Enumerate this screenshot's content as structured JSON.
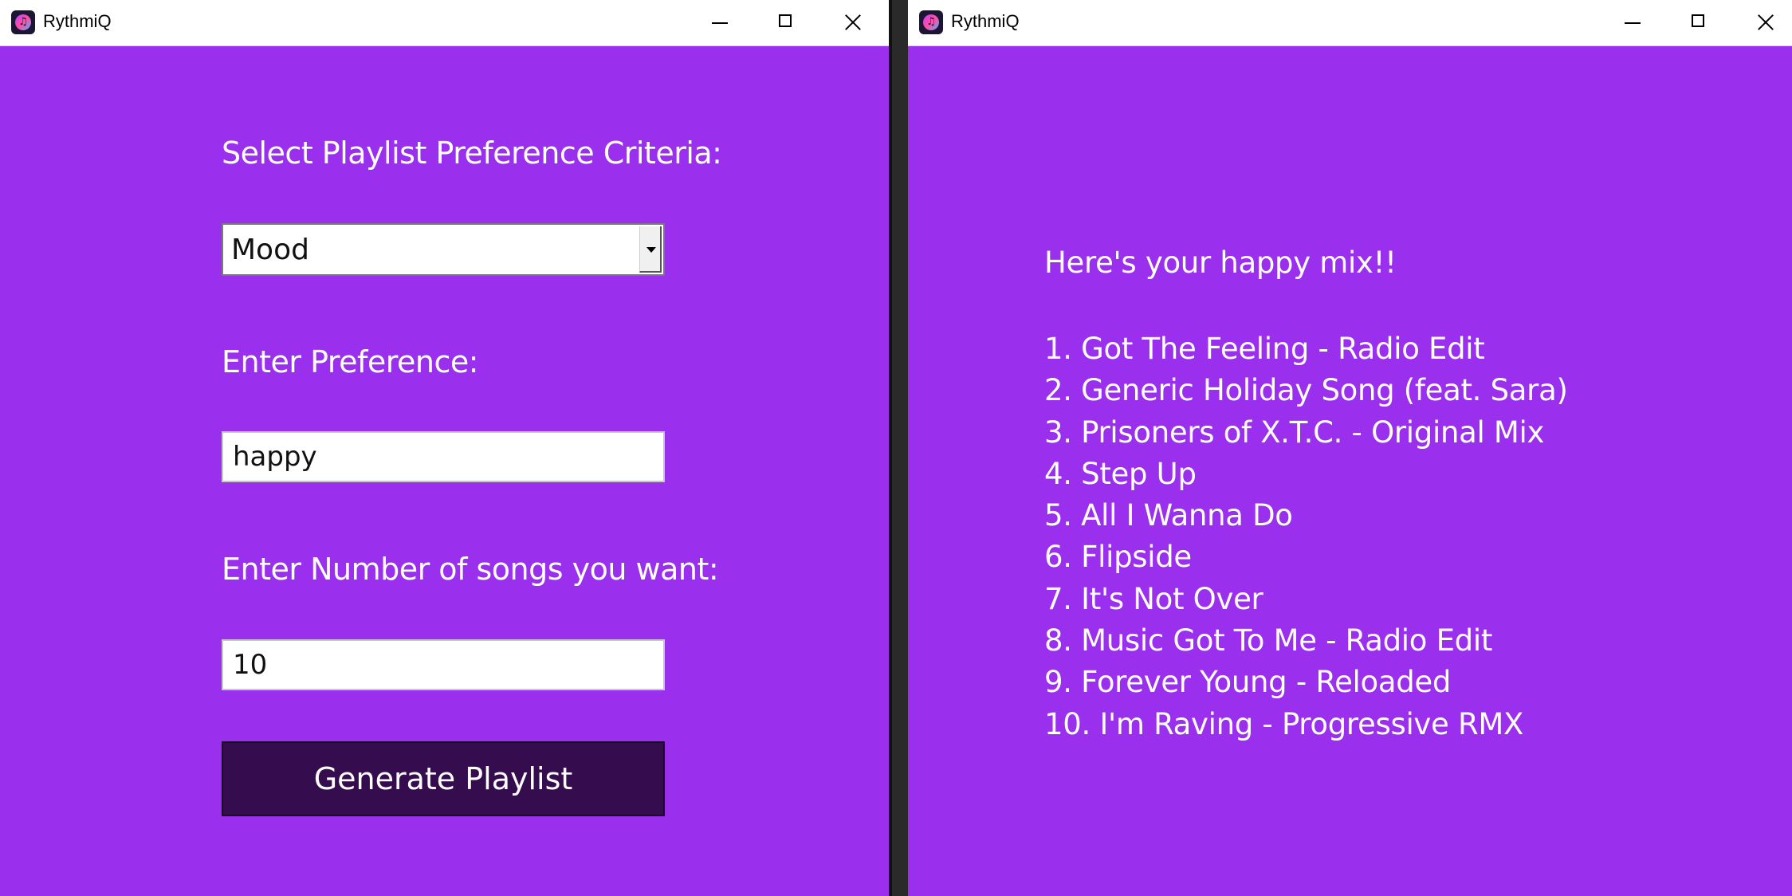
{
  "colors": {
    "background": "#9a2fee",
    "button": "#350c4d",
    "text": "#ffffff"
  },
  "left_window": {
    "title": "RythmiQ",
    "criteria_label": "Select Playlist Preference Criteria:",
    "criteria_value": "Mood",
    "preference_label": "Enter Preference:",
    "preference_value": "happy",
    "count_label": "Enter Number of songs you want:",
    "count_value": "10",
    "generate_label": "Generate Playlist"
  },
  "right_window": {
    "title": "RythmiQ",
    "heading": "Here's your happy mix!!",
    "songs": [
      "1. Got The Feeling - Radio Edit",
      "2. Generic Holiday Song (feat. Sara)",
      "3. Prisoners of X.T.C. - Original Mix",
      "4. Step Up",
      "5. All I Wanna Do",
      "6. Flipside",
      "7. It's Not Over",
      "8. Music Got To Me - Radio Edit",
      "9. Forever Young - Reloaded",
      "10. I'm Raving - Progressive RMX"
    ]
  }
}
